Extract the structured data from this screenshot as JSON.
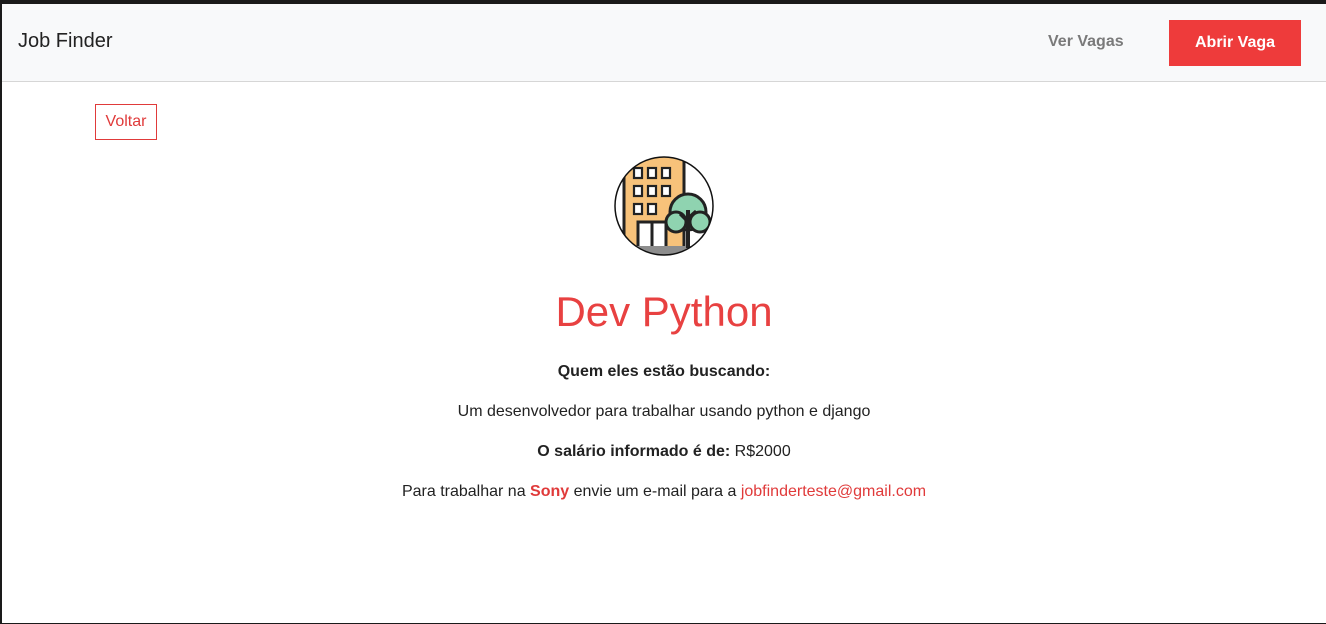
{
  "navbar": {
    "brand": "Job Finder",
    "link_label": "Ver Vagas",
    "cta_label": "Abrir Vaga"
  },
  "back_button": "Voltar",
  "job": {
    "title": "Dev Python",
    "looking_label": "Quem eles estão buscando:",
    "description": "Um desenvolvedor para trabalhar usando python e django",
    "salary_label": "O salário informado é de:",
    "salary_value": "R$2000",
    "contact_prefix": "Para trabalhar na",
    "company": "Sony",
    "contact_middle": "envie um e-mail para a",
    "email": "jobfinderteste@gmail.com"
  },
  "colors": {
    "accent": "#ee3b3b",
    "navbar_bg": "#f8f9fa"
  },
  "icons": {
    "company_logo": "building-tree-icon"
  }
}
